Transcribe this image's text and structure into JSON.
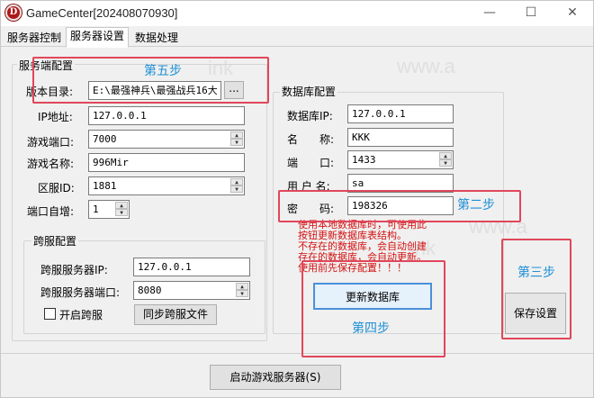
{
  "window": {
    "title": "GameCenter[202408070930]",
    "icon_letter": "D",
    "controls": {
      "minimize": "—",
      "maximize": "☐",
      "close": "✕"
    }
  },
  "tabs": [
    {
      "label": "服务器控制",
      "active": false
    },
    {
      "label": "服务器设置",
      "active": true
    },
    {
      "label": "数据处理",
      "active": false
    }
  ],
  "server_group": {
    "title": "服务端配置",
    "version_dir_label": "版本目录:",
    "version_dir_value": "E:\\最强神兵\\最强战兵16大",
    "browse_label": "...",
    "ip_label": "IP地址:",
    "ip_value": "127.0.0.1",
    "port_label": "游戏端口:",
    "port_value": "7000",
    "name_label": "游戏名称:",
    "name_value": "996Mir",
    "zone_label": "区服ID:",
    "zone_value": "1881",
    "autoinc_label": "端口自增:",
    "autoinc_value": "1"
  },
  "cross_group": {
    "title": "跨服配置",
    "ip_label": "跨服服务器IP:",
    "ip_value": "127.0.0.1",
    "port_label": "跨服服务器端口:",
    "port_value": "8080",
    "enable_label": "开启跨服",
    "enable_checked": false,
    "sync_button": "同步跨服文件"
  },
  "db_group": {
    "title": "数据库配置",
    "ip_label": "数据库IP:",
    "ip_value": "127.0.0.1",
    "name_label": "名　　称:",
    "name_value": "KKK",
    "port_label": "端　　口:",
    "port_value": "1433",
    "user_label": "用 户 名:",
    "user_value": "sa",
    "pwd_label": "密　　码:",
    "pwd_value": "198326",
    "notes": [
      "使用本地数据库时，可使用此",
      "按钮更新数据库表结构。",
      "不存在的数据库，会自动创建",
      "存在的数据库，会自动更新。",
      "使用前先保存配置！！！"
    ],
    "update_button": "更新数据库"
  },
  "save_button": "保存设置",
  "start_button": "启动游戏服务器(S)",
  "steps": {
    "step2": "第二步",
    "step3": "第三步",
    "step4": "第四步",
    "step5": "第五步"
  },
  "watermarks": [
    "www.a",
    "ink",
    "www.a",
    "ink"
  ],
  "colors": {
    "step_text": "#1e90d6",
    "highlight_border": "#e0475a",
    "note_text": "#d41010"
  }
}
